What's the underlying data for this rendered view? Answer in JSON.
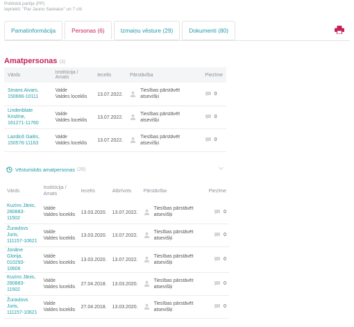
{
  "header": {
    "line1": "Politiskā partija (PP)",
    "line2": "Iepriekš: \"Par Jaunu Saskaņu\" un 7 citi"
  },
  "tabs": [
    {
      "label": "Pamatinformācija",
      "active": false
    },
    {
      "label": "Personas (6)",
      "active": true
    },
    {
      "label": "Izmaiņu vēsture (29)",
      "active": false
    },
    {
      "label": "Dokumenti (80)",
      "active": false
    }
  ],
  "print_icon": "printer-icon",
  "officials": {
    "title": "Amatpersonas",
    "count": "(3)",
    "columns": [
      "Vārds",
      "Institūcija / Amats",
      "Iecelts",
      "Pārstāvība",
      "Piezīme"
    ],
    "rows": [
      {
        "name": "Smans Aivars,",
        "code": "150666-10111",
        "institution": "Valde",
        "position": "Valdes loceklis",
        "appointed": "13.07.2022.",
        "representation": "Tiesības pārstāvēt atsevišķi",
        "notes": "0"
      },
      {
        "name": "Lindenblate Kristīne,",
        "code": "161271-11760",
        "institution": "Valde",
        "position": "Valdes loceklis",
        "appointed": "13.07.2022.",
        "representation": "Tiesības pārstāvēt atsevišķi",
        "notes": "0"
      },
      {
        "name": "Lazdiņš Gaitis,",
        "code": "150576-11163",
        "institution": "Valde",
        "position": "Valdes loceklis",
        "appointed": "13.07.2022.",
        "representation": "Tiesības pārstāvēt atsevišķi",
        "notes": "0"
      }
    ]
  },
  "history": {
    "title": "Vēsturiskās amatpersonas",
    "count": "(26)",
    "columns": [
      "Vārds",
      "Institūcija / Amats",
      "Iecelts",
      "Atbrīvots",
      "Pārstāvība",
      "Piezīme"
    ],
    "rows": [
      {
        "name": "Kuzins Jānis,",
        "code": "280883-11502",
        "institution": "Valde",
        "position": "Valdes loceklis",
        "appointed": "13.03.2020.",
        "released": "13.07.2022.",
        "rep1": "Tiesības pārstāvēt",
        "rep2": "atsevišķi",
        "notes": "0"
      },
      {
        "name": "Žuravļovs Juris,",
        "code": "111157-10621",
        "institution": "Valde",
        "position": "Valdes loceklis",
        "appointed": "13.03.2020.",
        "released": "13.07.2022.",
        "rep1": "Tiesības pārstāvēt",
        "rep2": "atsevišķi",
        "notes": "0"
      },
      {
        "name": "Jonāne Glorija,",
        "code": "010293-10606",
        "institution": "Valde",
        "position": "Valdes loceklis",
        "appointed": "13.03.2020.",
        "released": "13.07.2022.",
        "rep1": "Tiesības pārstāvēt",
        "rep2": "atsevišķi",
        "notes": "0"
      },
      {
        "name": "Kuzins Jānis,",
        "code": "280883-11502",
        "institution": "Valde",
        "position": "Valdes loceklis",
        "appointed": "27.04.2018.",
        "released": "13.03.2020.",
        "rep1": "Tiesības pārstāvēt",
        "rep2": "atsevišķi",
        "notes": "0"
      },
      {
        "name": "Žuravļovs Juris,",
        "code": "111157-10621",
        "institution": "Valde",
        "position": "Valdes loceklis",
        "appointed": "27.04.2018.",
        "released": "13.03.2020.",
        "rep1": "Tiesības pārstāvēt",
        "rep2": "atsevišķi",
        "notes": "0"
      }
    ]
  },
  "colors": {
    "accent": "#c5205a",
    "link": "#1f9aa8"
  }
}
